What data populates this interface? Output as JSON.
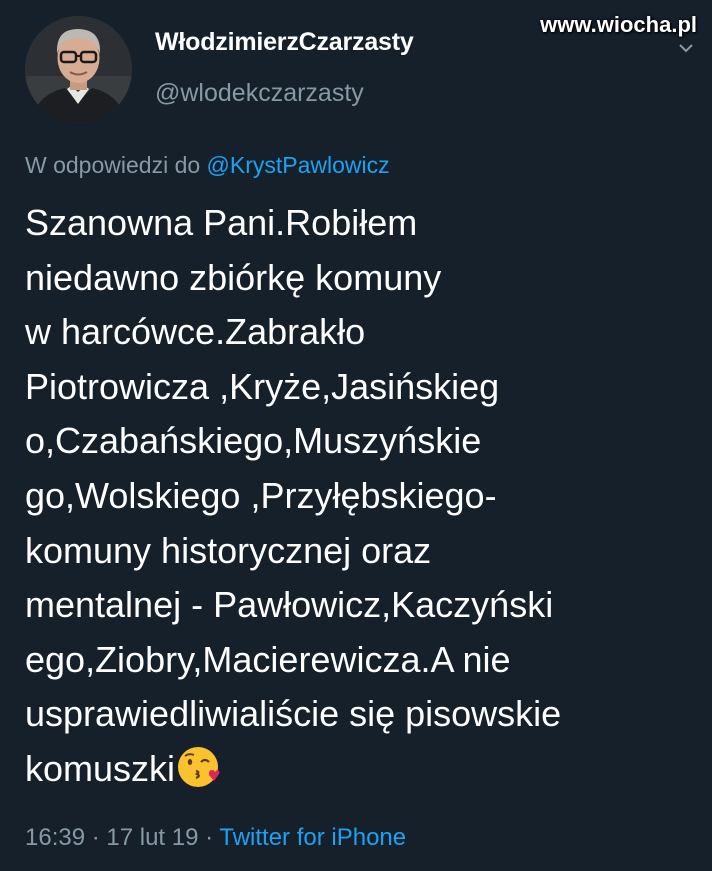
{
  "tweet": {
    "display_name": "WłodzimierzCzarzasty",
    "handle": "@wlodekczarzasty",
    "reply_prefix": "W odpowiedzi do ",
    "reply_mention": "@KrystPawlowicz",
    "body_lines": [
      "Szanowna Pani.Robiłem",
      "niedawno zbiórkę komuny",
      "w harcówce.Zabrakło",
      "Piotrowicza ,Kryże,Jasińskieg",
      "o,Czabańskiego,Muszyńskie",
      "go,Wolskiego ,Przyłębskiego-",
      "komuny historycznej oraz",
      "mentalnej - Pawłowicz,Kaczyński",
      "ego,Ziobry,Macierewicza.A nie",
      "usprawiedliwialiście się pisowskie",
      "komuszki"
    ],
    "emoji": "face-blowing-a-kiss",
    "time": "16:39",
    "sep1": " · ",
    "date": "17 lut 19",
    "sep2": " · ",
    "source": "Twitter for iPhone"
  },
  "watermark": "www.wiocha.pl",
  "icons": {
    "menu": "chevron-down-icon"
  },
  "colors": {
    "background": "#15202b",
    "text": "#ffffff",
    "secondary": "#8899a6",
    "link": "#1da1f2"
  }
}
